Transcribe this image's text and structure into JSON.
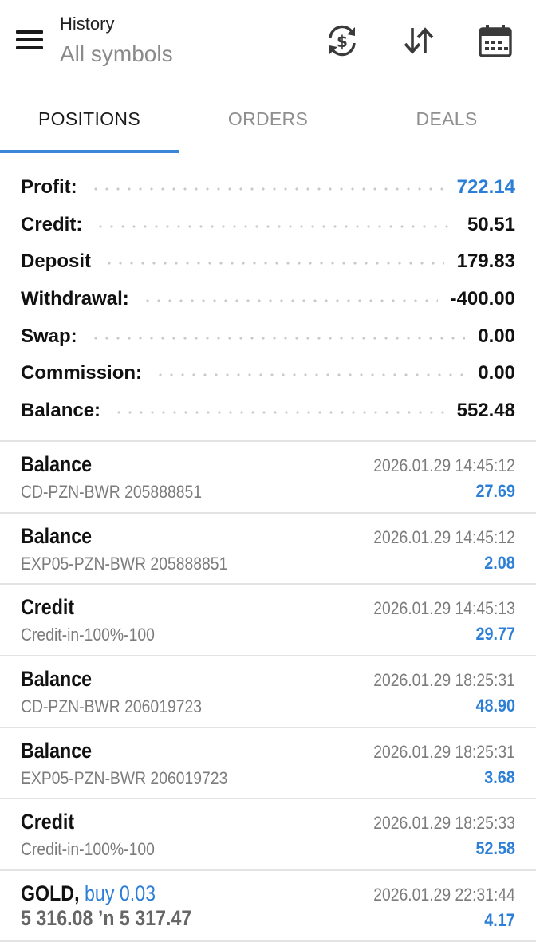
{
  "header": {
    "title": "History",
    "subtitle": "All symbols",
    "icons": {
      "menu": "hamburger-menu-icon",
      "sync": "currency-exchange-icon",
      "sort": "sort-arrows-icon",
      "calendar": "calendar-icon"
    }
  },
  "tabs": [
    {
      "label": "POSITIONS",
      "active": true
    },
    {
      "label": "ORDERS",
      "active": false
    },
    {
      "label": "DEALS",
      "active": false
    }
  ],
  "summary": {
    "profit": {
      "label": "Profit:",
      "value": "722.14"
    },
    "credit": {
      "label": "Credit:",
      "value": "50.51"
    },
    "deposit": {
      "label": "Deposit",
      "value": "179.83"
    },
    "withdrawal": {
      "label": "Withdrawal:",
      "value": "-400.00"
    },
    "swap": {
      "label": "Swap:",
      "value": "0.00"
    },
    "commission": {
      "label": "Commission:",
      "value": "0.00"
    },
    "balance": {
      "label": "Balance:",
      "value": "552.48"
    }
  },
  "deals": [
    {
      "title": "Balance",
      "comment": "CD-PZN-BWR 205888851",
      "time": "2026.01.29 14:45:12",
      "amount": "27.69"
    },
    {
      "title": "Balance",
      "comment": "EXP05-PZN-BWR 205888851",
      "time": "2026.01.29 14:45:12",
      "amount": "2.08"
    },
    {
      "title": "Credit",
      "comment": "Credit-in-100%-100",
      "time": "2026.01.29 14:45:13",
      "amount": "29.77"
    },
    {
      "title": "Balance",
      "comment": "CD-PZN-BWR 206019723",
      "time": "2026.01.29 18:25:31",
      "amount": "48.90"
    },
    {
      "title": "Balance",
      "comment": "EXP05-PZN-BWR 206019723",
      "time": "2026.01.29 18:25:31",
      "amount": "3.68"
    },
    {
      "title": "Credit",
      "comment": "Credit-in-100%-100",
      "time": "2026.01.29 18:25:33",
      "amount": "52.58"
    }
  ],
  "position": {
    "symbol": "GOLD,",
    "side": "buy 0.03",
    "prices": "5 316.08 ’n  5 317.47",
    "time": "2026.01.29 22:31:44",
    "amount": "4.17"
  },
  "colors": {
    "accent": "#2c7fd6",
    "tab_indicator": "#3a87d8",
    "divider": "#e3e3e3",
    "muted_text": "#7c7c7c"
  }
}
